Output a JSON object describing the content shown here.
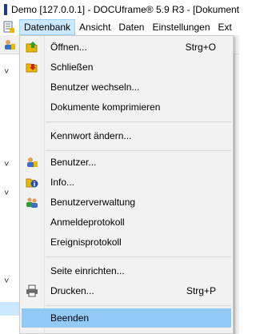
{
  "window": {
    "title": "Demo [127.0.0.1] - DOCUframe® 5.9 R3 - [Dokument"
  },
  "menubar": {
    "items": [
      {
        "label": "Datenbank"
      },
      {
        "label": "Ansicht"
      },
      {
        "label": "Daten"
      },
      {
        "label": "Einstellungen"
      },
      {
        "label": "Ext"
      }
    ]
  },
  "background": {
    "chevrons": [
      "˅",
      "˅",
      "˅",
      "˅"
    ]
  },
  "dropdown": {
    "items": [
      {
        "label": "Öffnen...",
        "shortcut": "Strg+O",
        "icon": "open-folder-icon"
      },
      {
        "label": "Schließen",
        "icon": "close-folder-icon"
      },
      {
        "label": "Benutzer wechseln..."
      },
      {
        "label": "Dokumente komprimieren"
      },
      {
        "label": "Kennwort ändern..."
      },
      {
        "label": "Benutzer...",
        "icon": "user-icon"
      },
      {
        "label": "Info...",
        "icon": "info-icon"
      },
      {
        "label": "Benutzerverwaltung",
        "icon": "users-icon"
      },
      {
        "label": "Anmeldeprotokoll"
      },
      {
        "label": "Ereignisprotokoll"
      },
      {
        "label": "Seite einrichten..."
      },
      {
        "label": "Drucken...",
        "shortcut": "Strg+P",
        "icon": "printer-icon"
      },
      {
        "label": "Beenden",
        "highlighted": true
      }
    ]
  },
  "colors": {
    "menu_background": "#f2f2f2",
    "active_menu": "#cce8ff",
    "highlight": "#91c9f7",
    "folder_yellow": "#e8b800",
    "arrow_green": "#2e9c2e",
    "arrow_red": "#d62020",
    "info_blue": "#2450b8"
  }
}
